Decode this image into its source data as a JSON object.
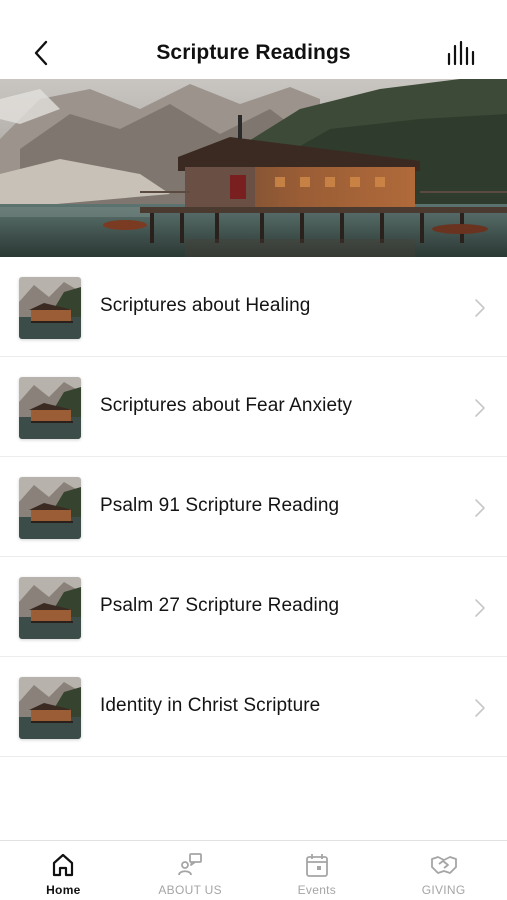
{
  "header": {
    "title": "Scripture Readings",
    "back_icon": "chevron-left-icon",
    "right_icon": "audio-bars-icon"
  },
  "hero": {
    "icon": "lake-boathouse-image"
  },
  "list": {
    "items": [
      {
        "label": "Scriptures about Healing"
      },
      {
        "label": "Scriptures about Fear Anxiety"
      },
      {
        "label": "Psalm 91 Scripture Reading"
      },
      {
        "label": "Psalm 27 Scripture Reading"
      },
      {
        "label": "Identity in Christ Scripture"
      }
    ]
  },
  "tabbar": {
    "tabs": [
      {
        "label": "Home",
        "icon": "home-icon",
        "active": true
      },
      {
        "label": "ABOUT US",
        "icon": "people-chat-icon",
        "active": false
      },
      {
        "label": "Events",
        "icon": "calendar-icon",
        "active": false
      },
      {
        "label": "GIVING",
        "icon": "handshake-icon",
        "active": false
      }
    ]
  },
  "colors": {
    "active_tab": "#111111",
    "inactive_tab": "#a5a5a5",
    "divider": "#ececec"
  }
}
